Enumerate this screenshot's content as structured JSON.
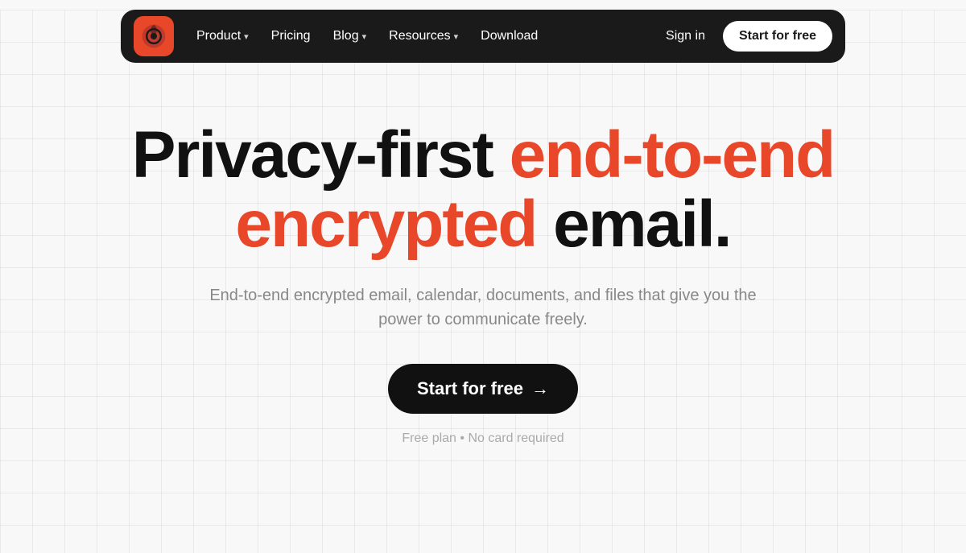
{
  "nav": {
    "logo_alt": "Proton Mail Logo",
    "links": [
      {
        "label": "Product",
        "has_chevron": true,
        "id": "product"
      },
      {
        "label": "Pricing",
        "has_chevron": false,
        "id": "pricing"
      },
      {
        "label": "Blog",
        "has_chevron": true,
        "id": "blog"
      },
      {
        "label": "Resources",
        "has_chevron": true,
        "id": "resources"
      },
      {
        "label": "Download",
        "has_chevron": false,
        "id": "download"
      }
    ],
    "signin_label": "Sign in",
    "cta_label": "Start for free"
  },
  "hero": {
    "headline_part1": "Privacy-first ",
    "headline_part2": "end-to-end",
    "headline_part3": "encrypted",
    "headline_part4": " email.",
    "subtext": "End-to-end encrypted email, calendar, documents, and files that give you the power to communicate freely.",
    "cta_label": "Start for free",
    "cta_arrow": "→",
    "footnote": "Free plan • No card required"
  },
  "colors": {
    "brand_orange": "#e8472a",
    "nav_bg": "#1a1a1a",
    "cta_bg": "#111111",
    "text_primary": "#111111",
    "text_muted": "#888888",
    "text_footnote": "#aaaaaa"
  }
}
